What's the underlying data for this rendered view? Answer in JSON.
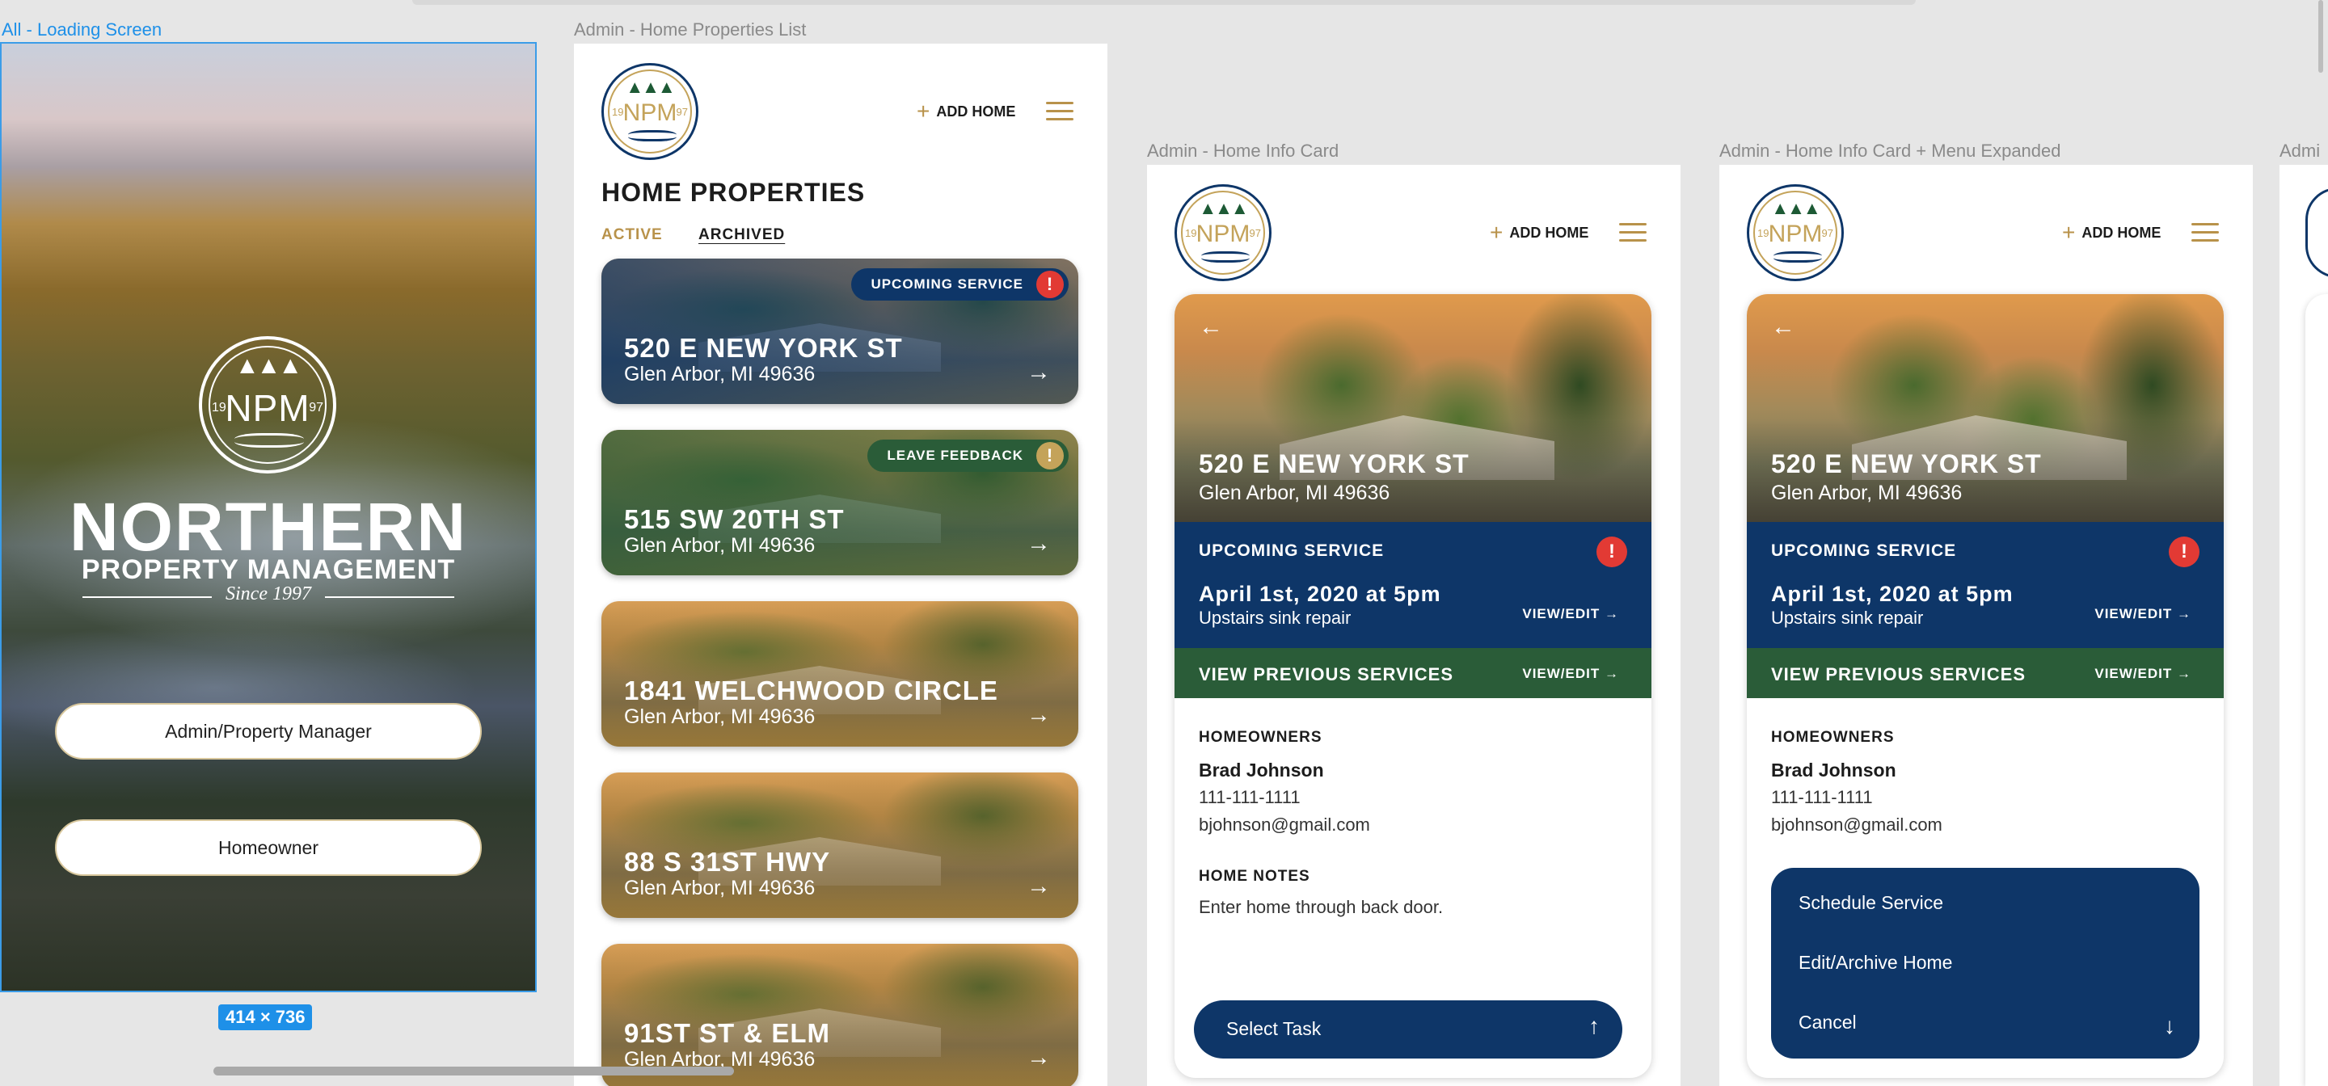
{
  "frames": {
    "loading": {
      "label": "All - Loading Screen",
      "size_badge": "414 × 736"
    },
    "list": {
      "label": "Admin - Home Properties List"
    },
    "info": {
      "label": "Admin - Home Info Card"
    },
    "info_menu": {
      "label": "Admin - Home Info Card + Menu Expanded"
    },
    "peek": {
      "label": "Admi"
    }
  },
  "loading": {
    "logo_text": "NPM",
    "logo_year_left": "19",
    "logo_year_right": "97",
    "brand_name": "NORTHERN",
    "brand_sub": "PROPERTY MANAGEMENT",
    "brand_since": "Since 1997",
    "buttons": [
      "Admin/Property Manager",
      "Homeowner"
    ]
  },
  "header": {
    "logo_text": "NPM",
    "logo_year_left": "19",
    "logo_year_right": "97",
    "trees": "▲▲▲",
    "add_home": "ADD HOME"
  },
  "list": {
    "title": "HOME PROPERTIES",
    "tabs": [
      "ACTIVE",
      "ARCHIVED"
    ],
    "cards": [
      {
        "address": "520 E NEW YORK ST",
        "city": "Glen Arbor, MI 49636",
        "badge": "UPCOMING SERVICE",
        "badge_color": "#0e3668",
        "alert_color": "#e23a34",
        "tint": "#0e3668"
      },
      {
        "address": "515 SW 20TH ST",
        "city": "Glen Arbor, MI 49636",
        "badge": "LEAVE FEEDBACK",
        "badge_color": "#2a5c38",
        "alert_color": "#c4a35a",
        "tint": "#2a5c38"
      },
      {
        "address": "1841 WELCHWOOD CIRCLE",
        "city": "Glen Arbor, MI 49636"
      },
      {
        "address": "88 S 31ST HWY",
        "city": "Glen Arbor, MI 49636"
      },
      {
        "address": "91ST ST & ELM",
        "city": "Glen Arbor, MI 49636"
      }
    ]
  },
  "info": {
    "address": "520 E NEW YORK ST",
    "city": "Glen Arbor, MI 49636",
    "upcoming_label": "UPCOMING SERVICE",
    "service_date": "April 1st, 2020 at 5pm",
    "service_desc": "Upstairs sink repair",
    "view_edit": "VIEW/EDIT",
    "previous_label": "VIEW PREVIOUS SERVICES",
    "homeowners_label": "HOMEOWNERS",
    "owner_name": "Brad Johnson",
    "owner_phone": "111-111-1111",
    "owner_email": "bjohnson@gmail.com",
    "notes_label": "HOME NOTES",
    "notes": "Enter home through back door.",
    "select_task": "Select Task"
  },
  "menu": {
    "items": [
      "Schedule Service",
      "Edit/Archive Home",
      "Cancel"
    ]
  },
  "icons": {
    "arrow_right": "→",
    "arrow_left": "←",
    "arrow_up": "↑",
    "arrow_down": "↓",
    "alert": "!"
  },
  "colors": {
    "navy": "#0e3668",
    "green": "#2a5c38",
    "gold": "#b8924a",
    "alert_red": "#e23a34"
  }
}
